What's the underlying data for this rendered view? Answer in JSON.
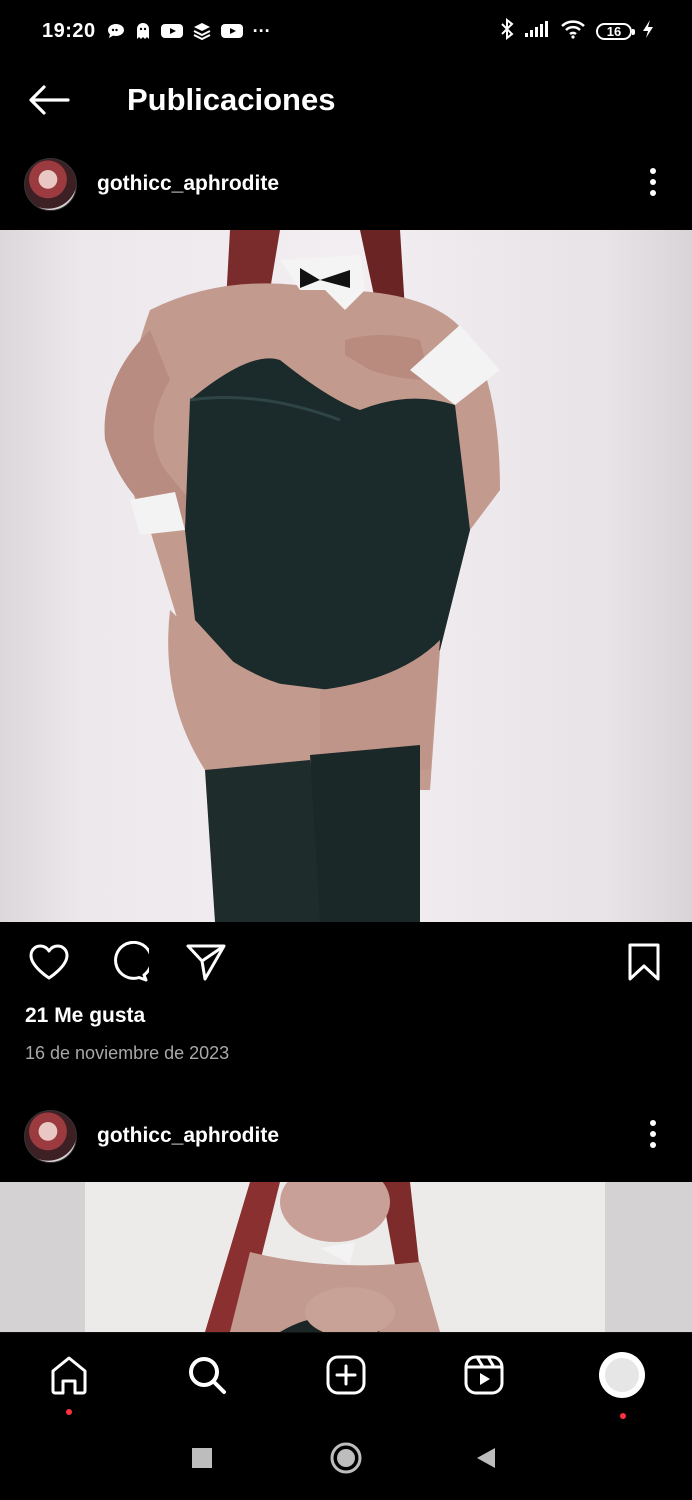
{
  "status_bar": {
    "time": "19:20",
    "notifications": [
      "chat-bubble-icon",
      "ghost-icon",
      "youtube-icon",
      "stack-icon",
      "youtube-icon"
    ],
    "more": "···",
    "battery": "16",
    "icons": [
      "bluetooth-icon",
      "signal-icon",
      "wifi-icon",
      "battery-icon",
      "charging-bolt-icon"
    ]
  },
  "header": {
    "title": "Publicaciones",
    "back_icon": "arrow-left-icon"
  },
  "posts": [
    {
      "username": "gothicc_aphrodite",
      "likes": "21 Me gusta",
      "date": "16 de noviembre de 2023"
    },
    {
      "username": "gothicc_aphrodite"
    }
  ],
  "actions": [
    "heart-icon",
    "comment-icon",
    "share-icon",
    "bookmark-icon"
  ],
  "bottom_nav": [
    "home-icon",
    "search-icon",
    "create-icon",
    "reels-icon",
    "profile-icon"
  ],
  "system_nav": [
    "recents-icon",
    "home-circle-icon",
    "back-triangle-icon"
  ],
  "colors": {
    "background": "#000000",
    "text": "#ffffff",
    "muted": "#a8a8a8",
    "notification_dot": "#ff3040"
  }
}
